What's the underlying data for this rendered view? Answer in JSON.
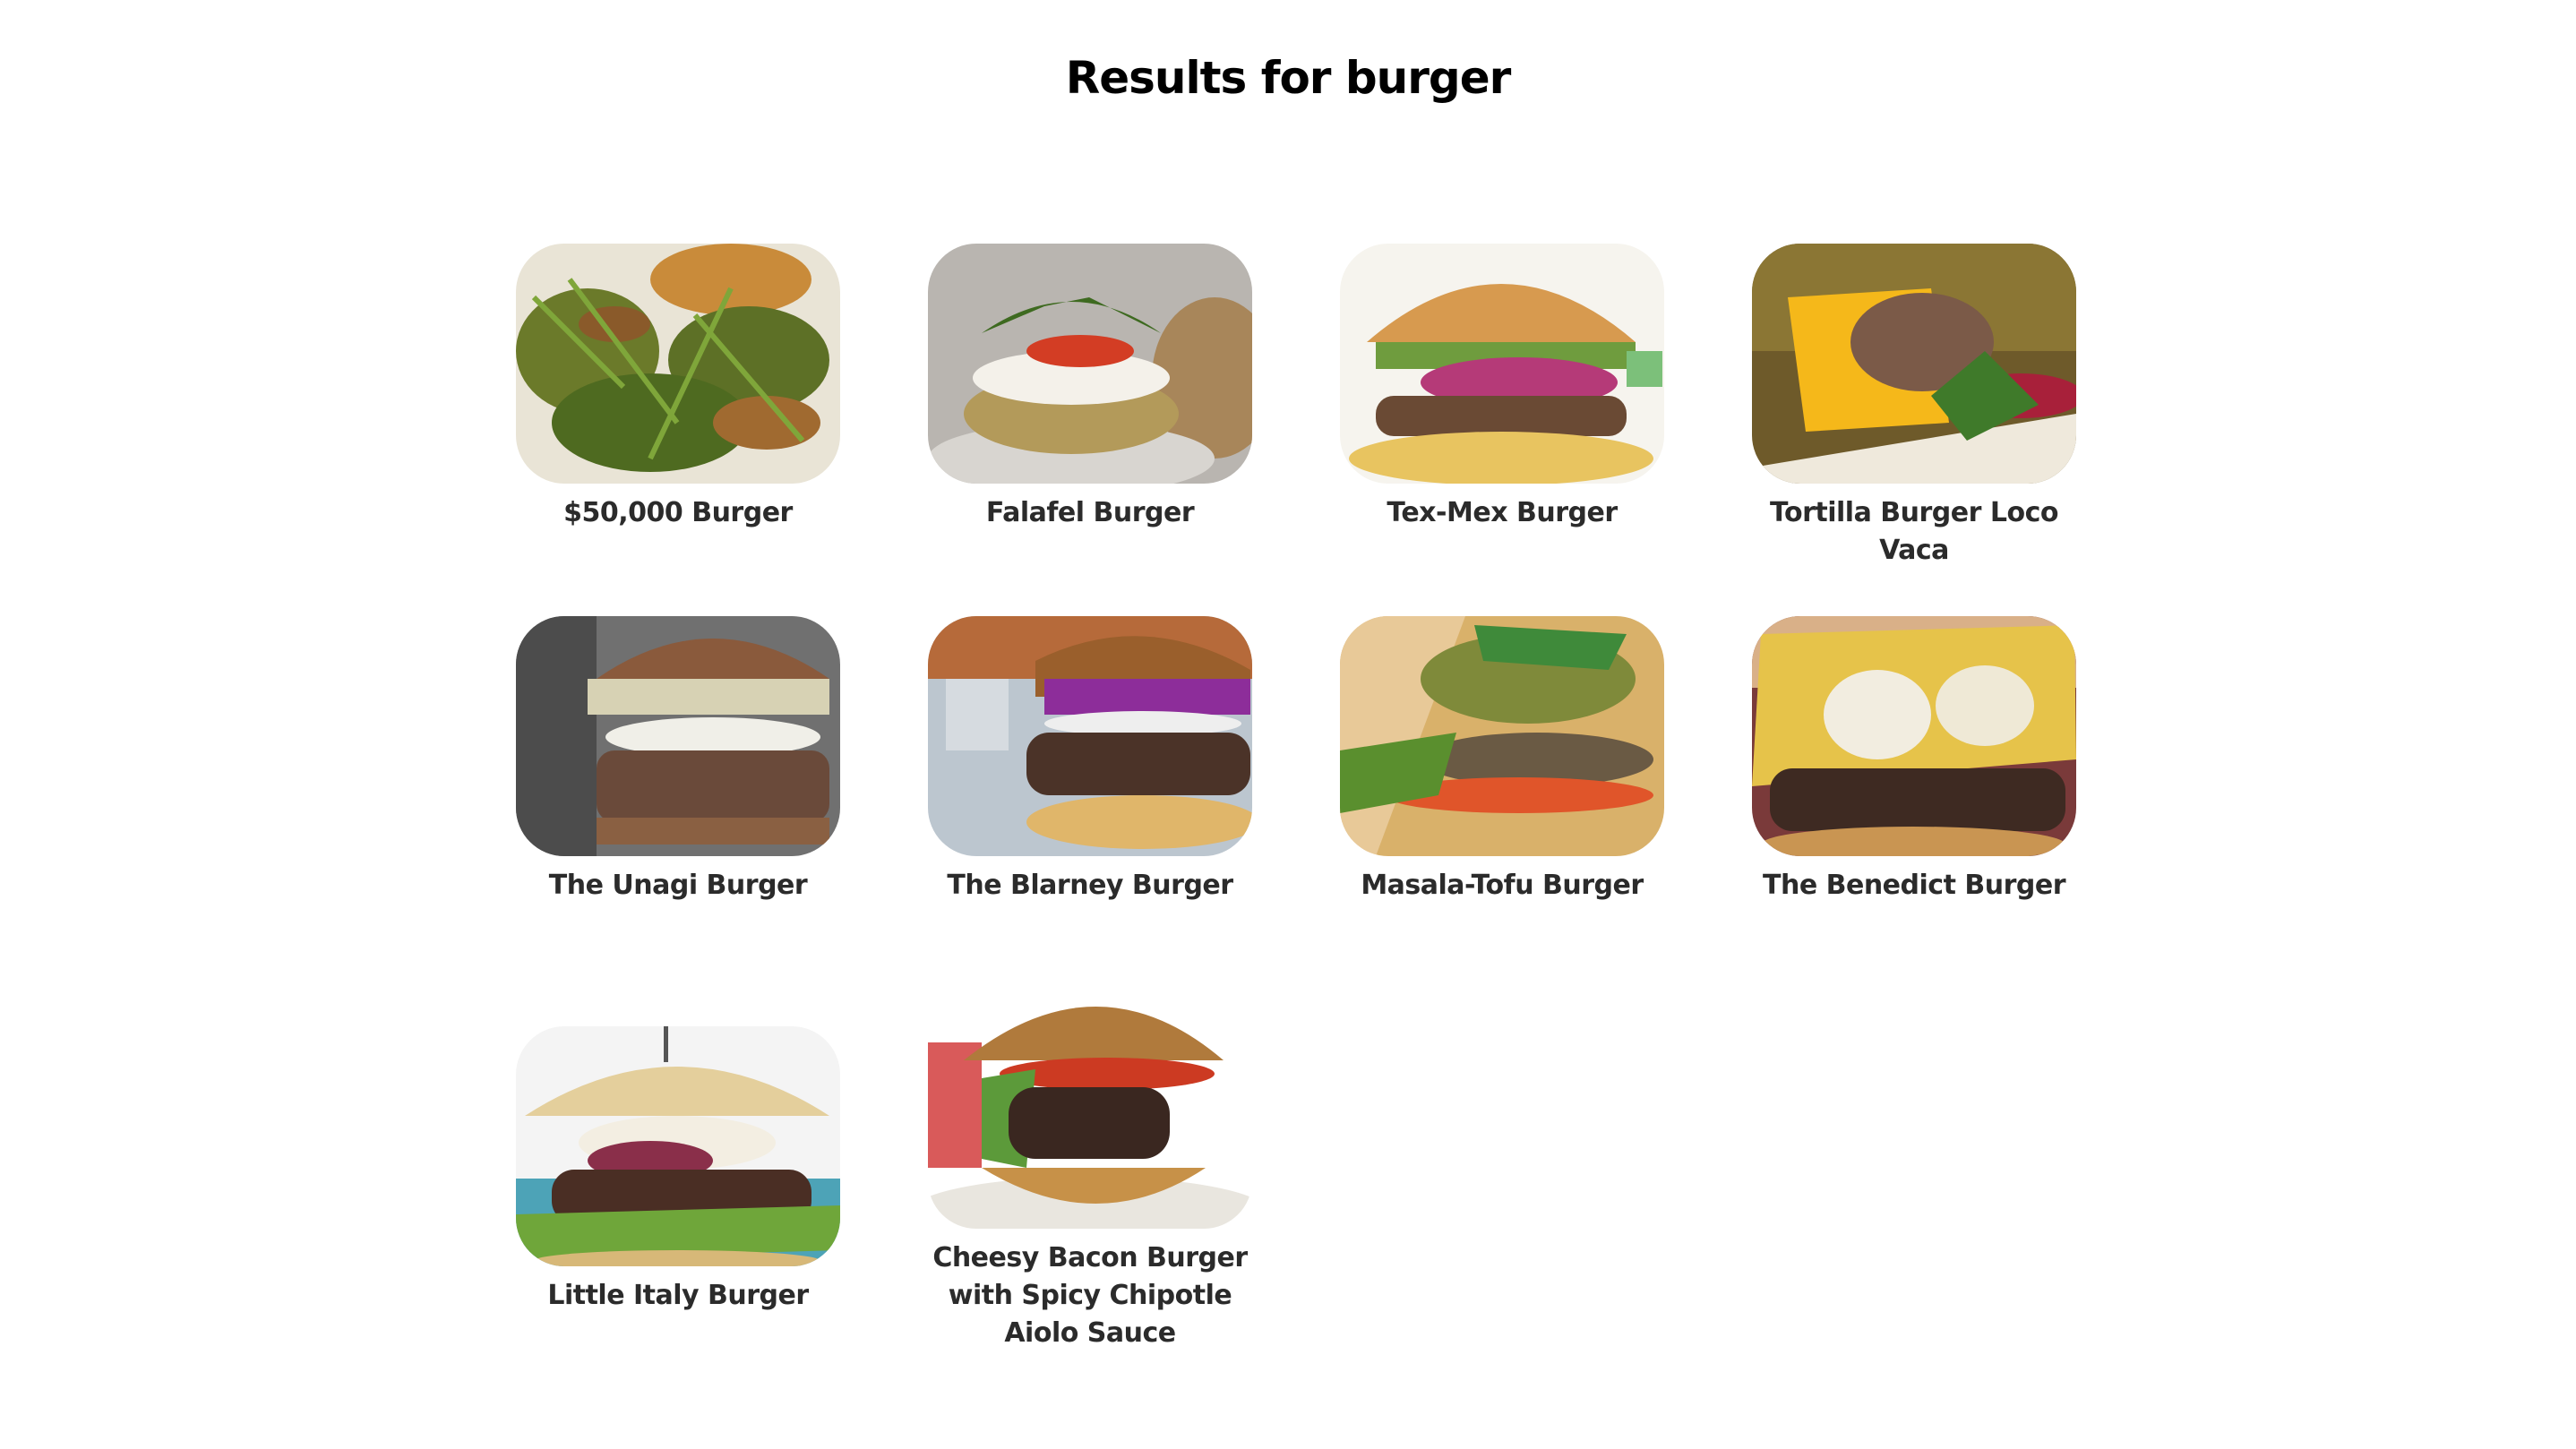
{
  "page": {
    "title": "Results for burger"
  },
  "results": [
    {
      "name": "$50,000 Burger",
      "image_icon": "burger-photo"
    },
    {
      "name": "Falafel Burger",
      "image_icon": "burger-photo"
    },
    {
      "name": "Tex-Mex Burger",
      "image_icon": "burger-photo"
    },
    {
      "name": "Tortilla Burger Loco Vaca",
      "image_icon": "burger-photo"
    },
    {
      "name": "The Unagi Burger",
      "image_icon": "burger-photo"
    },
    {
      "name": "The Blarney Burger",
      "image_icon": "burger-photo"
    },
    {
      "name": "Masala-Tofu Burger",
      "image_icon": "burger-photo"
    },
    {
      "name": "The Benedict Burger",
      "image_icon": "burger-photo"
    },
    {
      "name": "Little Italy Burger",
      "image_icon": "burger-photo"
    },
    {
      "name": "Cheesy Bacon Burger with Spicy Chipotle Aiolo Sauce",
      "image_icon": "burger-photo"
    }
  ]
}
